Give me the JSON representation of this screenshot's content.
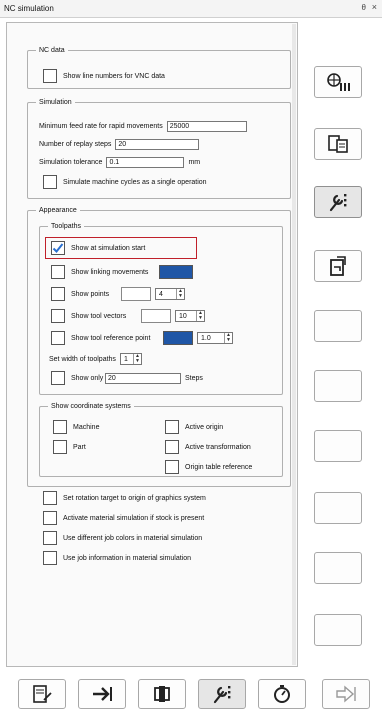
{
  "window": {
    "title": "NC simulation",
    "pin_glyph": "θ",
    "close_glyph": "×"
  },
  "nc_data": {
    "legend": "NC data",
    "show_line_numbers": "Show line numbers for VNC data"
  },
  "simulation": {
    "legend": "Simulation",
    "min_feed_label": "Minimum feed rate for rapid movements",
    "min_feed_value": "25000",
    "replay_steps_label": "Number of replay steps",
    "replay_steps_value": "20",
    "tolerance_label": "Simulation tolerance",
    "tolerance_value": "0.1",
    "tolerance_unit": "mm",
    "machine_cycles_label": "Simulate machine cycles as a single operation"
  },
  "appearance": {
    "legend": "Appearance",
    "toolpaths": {
      "legend": "Toolpaths",
      "show_at_start": "Show at simulation start",
      "show_linking": "Show linking movements",
      "show_points": "Show points",
      "points_value": "4",
      "show_tool_vectors": "Show tool vectors",
      "tool_vectors_value": "10",
      "show_tool_ref": "Show tool reference point",
      "tool_ref_value": "1.0",
      "set_width": "Set width of toolpaths",
      "width_value": "1",
      "show_only": "Show only",
      "show_only_value": "20",
      "steps": "Steps"
    },
    "coordinate_systems": {
      "legend": "Show coordinate systems",
      "machine": "Machine",
      "part": "Part",
      "active_origin": "Active origin",
      "active_transformation": "Active transformation",
      "origin_table_reference": "Origin table reference"
    }
  },
  "options": {
    "rotation_target": "Set rotation target to origin of graphics system",
    "material_sim": "Activate material simulation if stock is present",
    "job_colors": "Use different job colors in material simulation",
    "job_info": "Use job information in material simulation"
  },
  "colors": {
    "swatch": "#1f56a6",
    "highlight": "#c0202a",
    "check": "#2a6fcf"
  },
  "icons": {
    "side": [
      "nc-program-icon",
      "machine-table-icon",
      "settings-wrench-icon",
      "clipboard-export-icon"
    ],
    "bottom": [
      "document-edit-icon",
      "forward-arrow-icon",
      "toolpath-icon",
      "settings-wrench-icon",
      "stopwatch-icon",
      "exit-icon"
    ]
  }
}
